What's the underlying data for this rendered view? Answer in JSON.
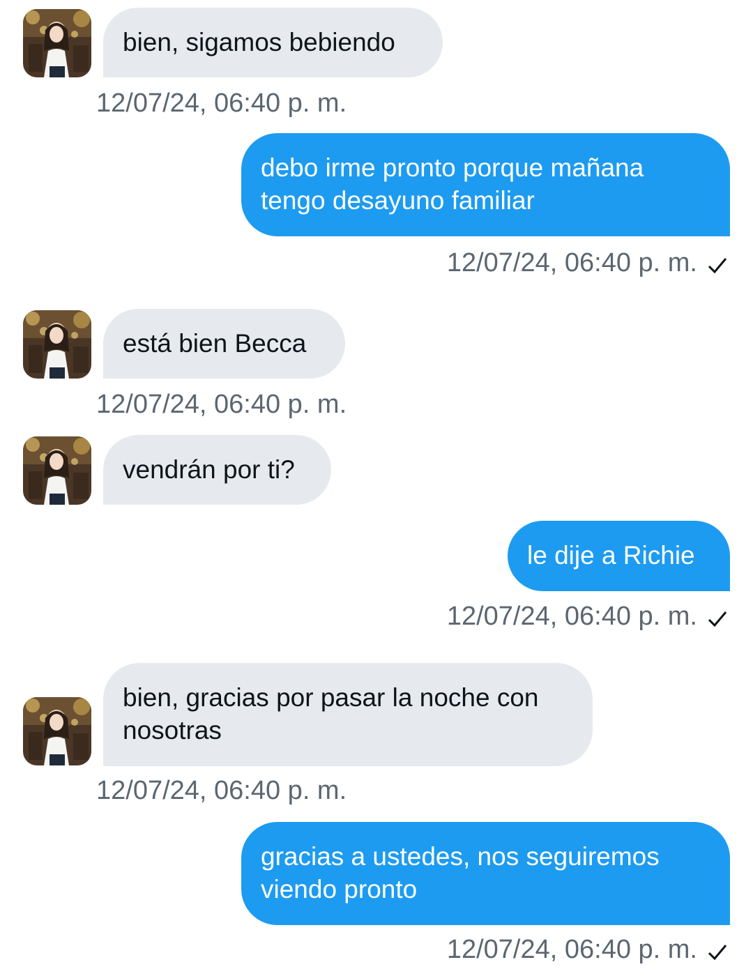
{
  "conversation": {
    "messages": [
      {
        "direction": "in",
        "text": "bien, sigamos bebiendo",
        "time": "12/07/24, 06:40 p. m."
      },
      {
        "direction": "out",
        "text": "debo irme pronto porque mañana tengo desayuno familiar",
        "time": "12/07/24, 06:40 p. m.",
        "status": "sent"
      },
      {
        "direction": "in",
        "text": "está bien Becca",
        "time": "12/07/24, 06:40 p. m."
      },
      {
        "direction": "in",
        "text": "vendrán por ti?",
        "time": "12/07/24, 06:40 p. m."
      },
      {
        "direction": "out",
        "text": "le dije a Richie",
        "time": "12/07/24, 06:40 p. m.",
        "status": "sent"
      },
      {
        "direction": "in",
        "text": "bien, gracias por pasar la noche con nosotras",
        "time": "12/07/24, 06:40 p. m."
      },
      {
        "direction": "out",
        "text": "gracias a ustedes, nos seguiremos viendo pronto",
        "time": "12/07/24, 06:40 p. m.",
        "status": "sent"
      }
    ]
  },
  "icons": {
    "sent_status": "checkmark-icon",
    "avatar": "contact-avatar-photo"
  },
  "colors": {
    "incoming_bubble": "#e6eaee",
    "outgoing_bubble": "#1d9bf0",
    "timestamp": "#5b6670"
  }
}
